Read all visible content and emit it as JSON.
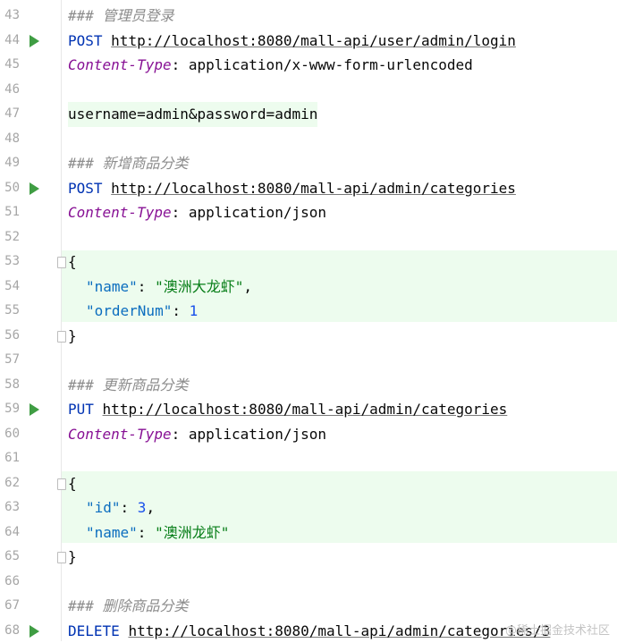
{
  "lines": [
    {
      "num": "43"
    },
    {
      "num": "44"
    },
    {
      "num": "45"
    },
    {
      "num": "46"
    },
    {
      "num": "47"
    },
    {
      "num": "48"
    },
    {
      "num": "49"
    },
    {
      "num": "50"
    },
    {
      "num": "51"
    },
    {
      "num": "52"
    },
    {
      "num": "53"
    },
    {
      "num": "54"
    },
    {
      "num": "55"
    },
    {
      "num": "56"
    },
    {
      "num": "57"
    },
    {
      "num": "58"
    },
    {
      "num": "59"
    },
    {
      "num": "60"
    },
    {
      "num": "61"
    },
    {
      "num": "62"
    },
    {
      "num": "63"
    },
    {
      "num": "64"
    },
    {
      "num": "65"
    },
    {
      "num": "66"
    },
    {
      "num": "67"
    },
    {
      "num": "68"
    }
  ],
  "code": {
    "l43_comment": "### 管理员登录",
    "l44_method": "POST",
    "l44_url": "http://localhost:8080/mall-api/user/admin/login",
    "l45_key": "Content-Type",
    "l45_val": ": application/x-www-form-urlencoded",
    "l47_body": "username=admin&password=admin",
    "l49_comment": "### 新增商品分类",
    "l50_method": "POST",
    "l50_url": "http://localhost:8080/mall-api/admin/categories",
    "l51_key": "Content-Type",
    "l51_val": ": application/json",
    "l53_open": "{",
    "l54_key": "\"name\"",
    "l54_colon": ": ",
    "l54_val": "\"澳洲大龙虾\"",
    "l54_comma": ",",
    "l55_key": "\"orderNum\"",
    "l55_colon": ": ",
    "l55_val": "1",
    "l56_close": "}",
    "l58_comment": "### 更新商品分类",
    "l59_method": "PUT",
    "l59_url": "http://localhost:8080/mall-api/admin/categories",
    "l60_key": "Content-Type",
    "l60_val": ": application/json",
    "l62_open": "{",
    "l63_key": "\"id\"",
    "l63_colon": ": ",
    "l63_val": "3",
    "l63_comma": ",",
    "l64_key": "\"name\"",
    "l64_colon": ": ",
    "l64_val": "\"澳洲龙虾\"",
    "l65_close": "}",
    "l67_comment": "### 删除商品分类",
    "l68_method": "DELETE",
    "l68_url": "http://localhost:8080/mall-api/admin/categories/3"
  },
  "watermark": "@稀土掘金技术社区",
  "icons": {
    "run": "run-request-icon (green play triangle)",
    "fold": "fold-marker-icon"
  },
  "colors": {
    "comment": "#8c8c8c",
    "method": "#0033b3",
    "header_key": "#871094",
    "json_key": "#0b6dbf",
    "json_string": "#067d17",
    "json_number": "#1750eb",
    "body_highlight": "#edfcee",
    "run_icon": "#3f9d43"
  }
}
